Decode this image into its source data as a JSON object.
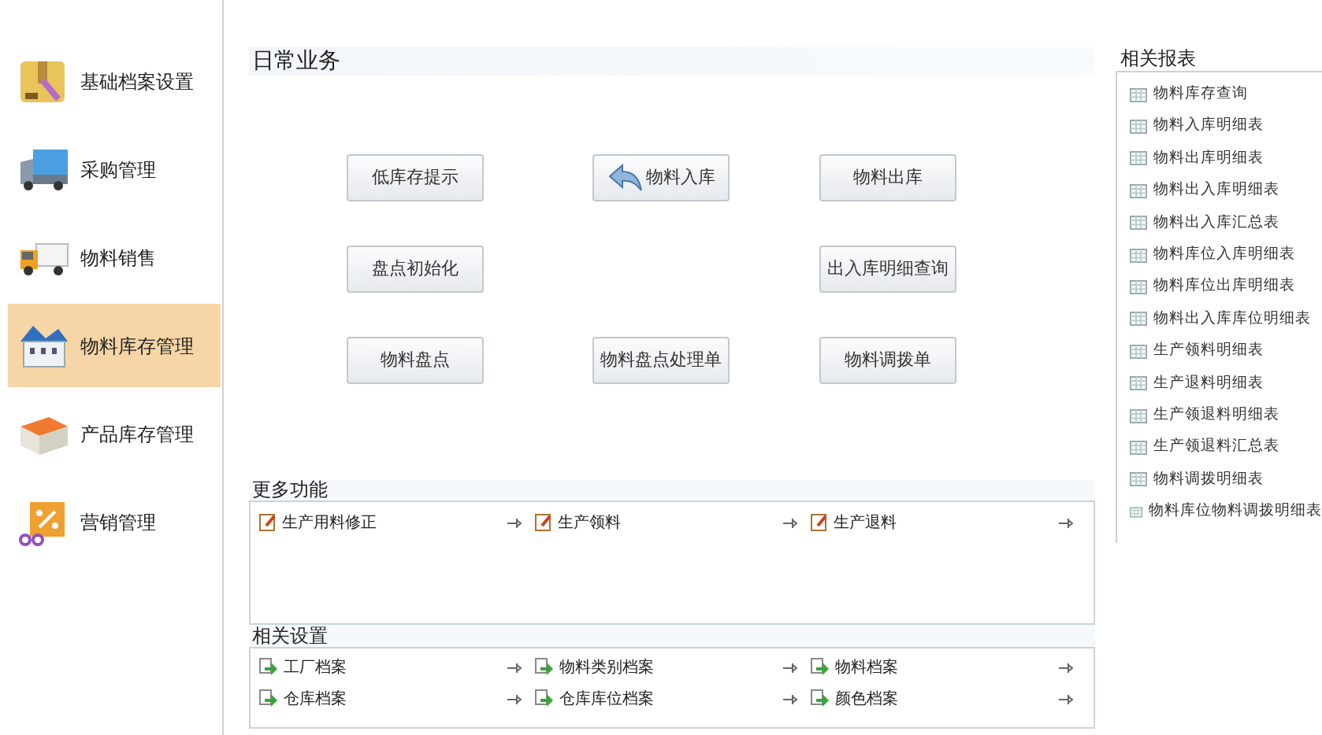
{
  "sidebar": {
    "items": [
      {
        "label": "基础档案设置",
        "kind": "folder",
        "selected": false
      },
      {
        "label": "采购管理",
        "kind": "truck",
        "selected": false
      },
      {
        "label": "物料销售",
        "kind": "lorry",
        "selected": false
      },
      {
        "label": "物料库存管理",
        "kind": "house",
        "selected": true
      },
      {
        "label": "产品库存管理",
        "kind": "warehouse",
        "selected": false
      },
      {
        "label": "营销管理",
        "kind": "discount",
        "selected": false
      }
    ]
  },
  "daily": {
    "title": "日常业务",
    "rows": [
      [
        {
          "label": "低库存提示"
        },
        {
          "label": "物料入库",
          "kind": "return"
        },
        {
          "label": "物料出库"
        }
      ],
      [
        {
          "label": "盘点初始化"
        },
        null,
        {
          "label": "出入库明细查询"
        }
      ],
      [
        {
          "label": "物料盘点"
        },
        {
          "label": "物料盘点处理单"
        },
        {
          "label": "物料调拨单"
        }
      ]
    ]
  },
  "more_functions": {
    "title": "更多功能",
    "items": [
      {
        "label": "生产用料修正"
      },
      {
        "label": "生产领料"
      },
      {
        "label": "生产退料"
      }
    ]
  },
  "related_settings": {
    "title": "相关设置",
    "items": [
      {
        "label": "工厂档案"
      },
      {
        "label": "物料类别档案"
      },
      {
        "label": "物料档案"
      },
      {
        "label": "仓库档案"
      },
      {
        "label": "仓库库位档案"
      },
      {
        "label": "颜色档案"
      }
    ]
  },
  "related_reports": {
    "title": "相关报表",
    "items": [
      "物料库存查询",
      "物料入库明细表",
      "物料出库明细表",
      "物料出入库明细表",
      "物料出入库汇总表",
      "物料库位入库明细表",
      "物料库位出库明细表",
      "物料出入库库位明细表",
      "生产领料明细表",
      "生产退料明细表",
      "生产领退料明细表",
      "生产领退料汇总表",
      "物料调拨明细表",
      "物料库位物料调拨明细表"
    ]
  }
}
